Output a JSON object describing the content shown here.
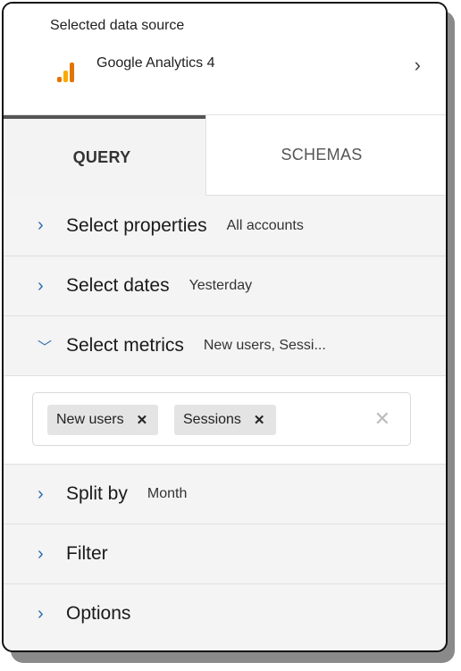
{
  "source": {
    "label": "Selected data source",
    "name": "Google Analytics 4",
    "icon": "google-analytics-icon",
    "chevron": "›"
  },
  "tabs": [
    {
      "label": "QUERY",
      "active": true
    },
    {
      "label": "SCHEMAS",
      "active": false
    }
  ],
  "rows": {
    "properties": {
      "title": "Select properties",
      "value": "All accounts"
    },
    "dates": {
      "title": "Select dates",
      "value": "Yesterday"
    },
    "metrics": {
      "title": "Select metrics",
      "value": "New users, Sessi..."
    },
    "split": {
      "title": "Split by",
      "value": "Month"
    },
    "filter": {
      "title": "Filter"
    },
    "options": {
      "title": "Options"
    }
  },
  "metrics": {
    "chips": [
      {
        "label": "New users",
        "remove": "✕"
      },
      {
        "label": "Sessions",
        "remove": "✕"
      }
    ],
    "clear": "✕"
  },
  "colors": {
    "chevron": "#2b6cb0",
    "ga_orange_dark": "#e37400",
    "ga_orange_light": "#f9ab00"
  }
}
